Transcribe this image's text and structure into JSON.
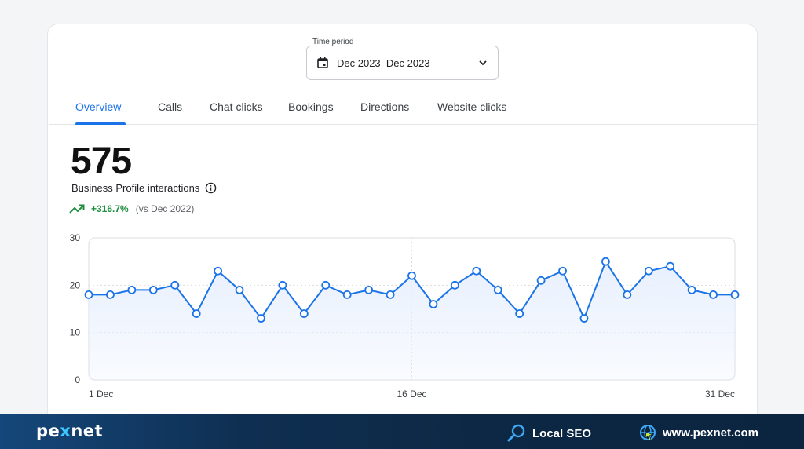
{
  "time_period": {
    "label": "Time period",
    "value": "Dec 2023–Dec 2023",
    "calendar_icon": "calendar-icon",
    "dropdown_icon": "chevron-down-icon"
  },
  "tabs": [
    {
      "label": "Overview",
      "active": true
    },
    {
      "label": "Calls",
      "active": false
    },
    {
      "label": "Chat clicks",
      "active": false
    },
    {
      "label": "Bookings",
      "active": false
    },
    {
      "label": "Directions",
      "active": false
    },
    {
      "label": "Website clicks",
      "active": false
    }
  ],
  "metric": {
    "value": "575",
    "label": "Business Profile interactions",
    "info_icon": "info-icon",
    "change": "+316.7%",
    "comparison": "(vs Dec 2022)",
    "trend_icon": "trending-up-icon"
  },
  "chart_data": {
    "type": "line",
    "x_tick_labels": [
      "1 Dec",
      "16 Dec",
      "31 Dec"
    ],
    "y_ticks": [
      0,
      10,
      20,
      30
    ],
    "ylim": [
      0,
      30
    ],
    "x": [
      1,
      2,
      3,
      4,
      5,
      6,
      7,
      8,
      9,
      10,
      11,
      12,
      13,
      14,
      15,
      16,
      17,
      18,
      19,
      20,
      21,
      22,
      23,
      24,
      25,
      26,
      27,
      28,
      29,
      30,
      31
    ],
    "values": [
      18,
      18,
      19,
      19,
      20,
      14,
      23,
      19,
      13,
      20,
      14,
      20,
      18,
      19,
      18,
      22,
      16,
      20,
      23,
      19,
      14,
      21,
      23,
      13,
      25,
      18,
      23,
      24,
      19,
      18,
      18
    ],
    "grid": true,
    "line_color": "#1a73e8",
    "fill_color": "#e8f0fe"
  },
  "footer": {
    "brand": {
      "prefix": "pe",
      "x": "x",
      "suffix": "net"
    },
    "service": "Local SEO",
    "service_icon": "search-icon",
    "website": "www.pexnet.com",
    "website_icon": "globe-cursor-icon"
  }
}
